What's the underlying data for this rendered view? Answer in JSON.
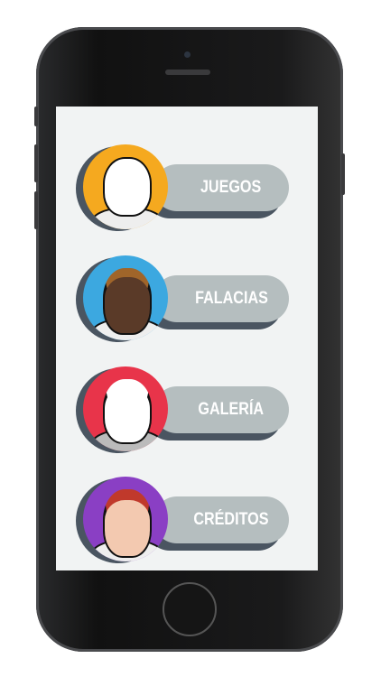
{
  "menu": [
    {
      "label": "JUEGOS",
      "color": "#f5a91f",
      "icon": "mustached-man-portrait"
    },
    {
      "label": "FALACIAS",
      "color": "#3ca8e0",
      "icon": "woman-with-scissors-portrait"
    },
    {
      "label": "GALERÍA",
      "color": "#e8344a",
      "icon": "man-with-cap-portrait"
    },
    {
      "label": "CRÉDITOS",
      "color": "#8a3fc4",
      "icon": "red-haired-woman-with-glasses-portrait"
    }
  ],
  "colors": {
    "button": "#b5bebf",
    "shadow": "#4a5561",
    "screen": "#f1f3f3"
  }
}
